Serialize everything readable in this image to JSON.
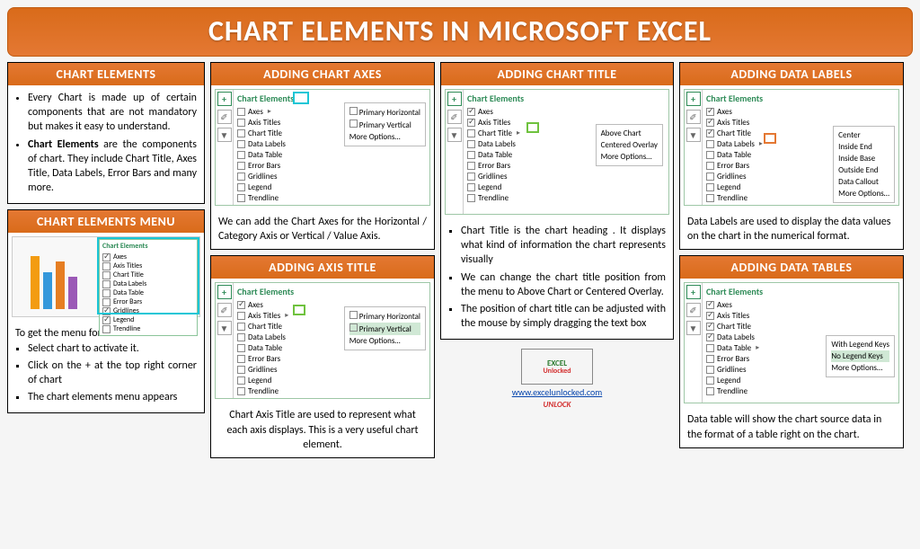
{
  "header": {
    "title": "CHART ELEMENTS IN MICROSOFT EXCEL"
  },
  "excel_menu": {
    "title": "Chart Elements",
    "items": [
      "Axes",
      "Axis Titles",
      "Chart Title",
      "Data Labels",
      "Data Table",
      "Error Bars",
      "Gridlines",
      "Legend",
      "Trendline"
    ]
  },
  "cards": {
    "chart_elements": {
      "title": "CHART ELEMENTS",
      "bullets": [
        "Every Chart is made up of certain components that are not mandatory but makes it easy to understand.",
        "Chart Elements are the components of chart. They include Chart Title, Axes Title, Data Labels, Error Bars and many more."
      ]
    },
    "menu": {
      "title": "CHART ELEMENTS MENU",
      "intro": "To get the menu for chart elements–",
      "bullets": [
        "Select chart to activate it.",
        "Click on the + at the top right corner of chart",
        "The chart elements menu appears"
      ]
    },
    "axes": {
      "title": "ADDING CHART AXES",
      "flyout": [
        "Primary Horizontal",
        "Primary Vertical",
        "More Options…"
      ],
      "caption": "We can add the Chart Axes for the Horizontal / Category Axis or Vertical / Value Axis."
    },
    "axis_title": {
      "title": "ADDING AXIS TITLE",
      "flyout": [
        "Primary Horizontal",
        "Primary Vertical",
        "More Options…"
      ],
      "caption": "Chart Axis Title are used to represent what each axis displays. This is a very useful chart element."
    },
    "chart_title": {
      "title": "ADDING CHART TITLE",
      "flyout": [
        "Above Chart",
        "Centered Overlay",
        "More Options…"
      ],
      "bullets": [
        "Chart Title is the chart heading . It displays what kind of information the chart represents visually",
        "We can change the chart title position from the menu to Above Chart or Centered Overlay.",
        "The position of chart title can be adjusted with the mouse by simply dragging the text box"
      ]
    },
    "data_labels": {
      "title": "ADDING DATA LABELS",
      "flyout": [
        "Center",
        "Inside End",
        "Inside Base",
        "Outside End",
        "Data Callout",
        "More Options…"
      ],
      "caption": "Data Labels are used to display the data values on the chart in the numerical format."
    },
    "data_tables": {
      "title": "ADDING DATA TABLES",
      "flyout": [
        "With Legend Keys",
        "No Legend Keys",
        "More Options…"
      ],
      "caption": "Data table will show the chart source data in the format of a table right on the chart."
    }
  },
  "logo": {
    "top": "EXCEL",
    "bottom": "Unlocked",
    "url": "www.excelunlocked.com",
    "tag": "UNLOCK"
  },
  "side_icons": {
    "plus": "+",
    "brush": "✐",
    "filter": "▼"
  }
}
